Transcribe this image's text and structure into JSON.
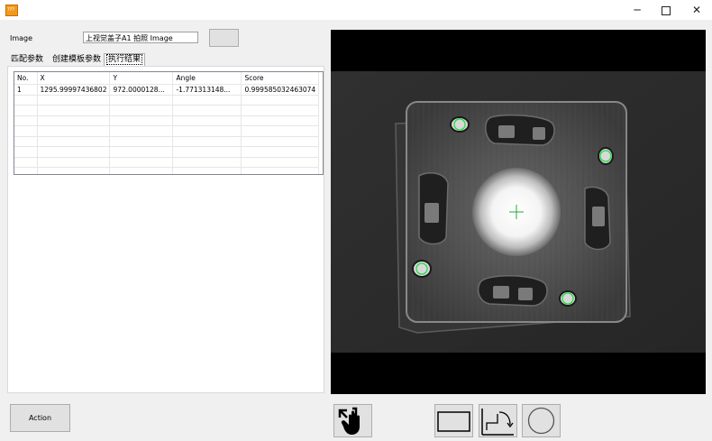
{
  "window": {
    "app_icon_text": "???",
    "minimize_glyph": "─",
    "close_glyph": "✕"
  },
  "left": {
    "image_label": "Image",
    "image_value": "上视觉盖子A1 拍照 Image",
    "tabs": [
      "匹配参数",
      "创建模板参数",
      "执行结果"
    ],
    "active_tab": 2,
    "grid": {
      "columns": [
        "No.",
        "X",
        "Y",
        "Angle",
        "Score"
      ],
      "rows": [
        [
          "1",
          "1295.99997436802",
          "972.0000128...",
          "-1.771313148...",
          "0.999585032463074"
        ]
      ]
    }
  },
  "bottom": {
    "action_label": "Action",
    "tools": [
      "pan-tool-icon",
      "rectangle-roi-icon",
      "rotated-rectangle-roi-icon",
      "circle-roi-icon"
    ]
  },
  "colors": {
    "accent_green": "#22dd44",
    "app_icon": "#f29a1c"
  }
}
